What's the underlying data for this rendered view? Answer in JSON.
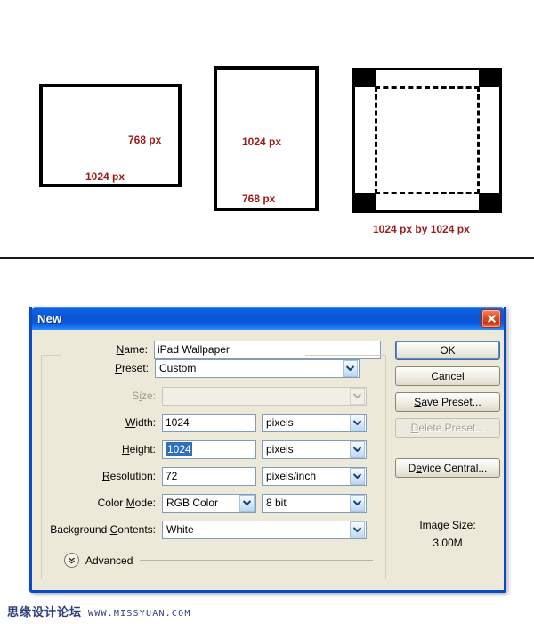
{
  "diagram": {
    "landscape": {
      "height_label": "768 px",
      "width_label": "1024 px"
    },
    "portrait": {
      "height_label": "1024 px",
      "width_label": "768 px"
    },
    "square": {
      "caption": "1024 px by 1024 px"
    },
    "label_color": "#9c1b1b"
  },
  "dialog": {
    "title": "New",
    "accent_color": "#0a49c8",
    "face_color": "#ece9d8",
    "fields": {
      "name": {
        "label": "Name:",
        "label_accel": "N",
        "value": "iPad Wallpaper"
      },
      "preset": {
        "label": "Preset:",
        "label_accel": "P",
        "value": "Custom"
      },
      "size": {
        "label": "Size:",
        "label_accel": "i",
        "value": "",
        "disabled": true
      },
      "width": {
        "label": "Width:",
        "label_accel": "W",
        "value": "1024",
        "unit": "pixels"
      },
      "height": {
        "label": "Height:",
        "label_accel": "H",
        "value": "1024",
        "unit": "pixels",
        "selected": true
      },
      "resolution": {
        "label": "Resolution:",
        "label_accel": "R",
        "value": "72",
        "unit": "pixels/inch"
      },
      "color_mode": {
        "label": "Color Mode:",
        "label_accel": "M",
        "value": "RGB Color",
        "depth": "8 bit"
      },
      "background_contents": {
        "label": "Background Contents:",
        "label_accel": "C",
        "value": "White"
      }
    },
    "advanced": {
      "label": "Advanced",
      "expanded": false
    },
    "buttons": {
      "ok": "OK",
      "cancel": "Cancel",
      "save_preset": "Save Preset...",
      "save_preset_accel": "S",
      "delete_preset": "Delete Preset...",
      "delete_preset_accel": "D",
      "delete_preset_disabled": true,
      "device_central": "Device Central...",
      "device_central_accel": "e"
    },
    "image_size": {
      "label": "Image Size:",
      "value": "3.00M"
    }
  },
  "watermark": {
    "site_name": "思缘设计论坛",
    "url": "WWW.MISSYUAN.COM"
  }
}
